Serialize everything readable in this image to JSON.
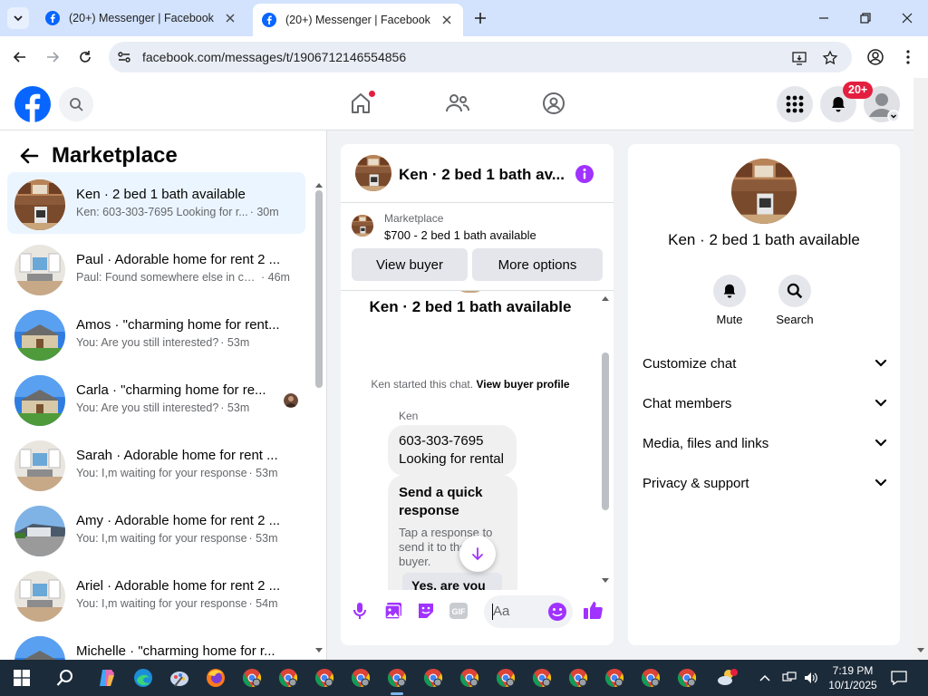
{
  "browser": {
    "tabs": [
      {
        "title": "(20+) Messenger | Facebook",
        "active": false
      },
      {
        "title": "(20+) Messenger | Facebook",
        "active": true
      }
    ],
    "url": "facebook.com/messages/t/1906712146554856"
  },
  "header": {
    "notification_badge": "20+"
  },
  "left_panel": {
    "title": "Marketplace",
    "conversations": [
      {
        "name": "Ken · 2 bed 1 bath available",
        "preview": "Ken: 603-303-7695 Looking for r...",
        "time": "· 30m",
        "selected": true,
        "thumb": "kitchen"
      },
      {
        "name": "Paul · Adorable home for rent 2 ...",
        "preview": "Paul: Found somewhere else in ca...",
        "time": "· 46m",
        "thumb": "living"
      },
      {
        "name": "Amos · \"charming home for rent...",
        "preview": "You: Are you still interested?",
        "time": "· 53m",
        "thumb": "house"
      },
      {
        "name": "Carla · \"charming home for re...",
        "preview": "You: Are you still interested?",
        "time": "· 53m",
        "thumb": "house"
      },
      {
        "name": "Sarah · Adorable home for rent ...",
        "preview": "You: I,m waiting for your response",
        "time": "· 53m",
        "thumb": "living"
      },
      {
        "name": "Amy · Adorable home for rent 2 ...",
        "preview": "You: I,m waiting for your response",
        "time": "· 53m",
        "thumb": "street"
      },
      {
        "name": "Ariel · Adorable home for rent 2 ...",
        "preview": "You: I,m waiting for your response",
        "time": "· 54m",
        "thumb": "living"
      },
      {
        "name": "Michelle · \"charming home for r...",
        "preview": "",
        "time": "",
        "thumb": "house"
      }
    ]
  },
  "chat": {
    "title": "Ken · 2 bed 1 bath av...",
    "marketplace_label": "Marketplace",
    "listing": "$700 - 2 bed 1 bath available",
    "view_buyer": "View buyer",
    "more_options": "More options",
    "intro_name": "Ken · 2 bed 1 bath available",
    "started_text": "Ken started this chat.",
    "view_buyer_profile": "View buyer profile",
    "sender": "Ken",
    "message_line1": "603-303-7695",
    "message_line2": "Looking for rental",
    "quick_title": "Send a quick response",
    "quick_sub": "Tap a response to send it to the buyer.",
    "quick_option": "Yes, are you",
    "composer_placeholder": "Aa"
  },
  "right_panel": {
    "name": "Ken · 2 bed 1 bath available",
    "mute": "Mute",
    "search": "Search",
    "sections": [
      "Customize chat",
      "Chat members",
      "Media, files and links",
      "Privacy & support"
    ]
  },
  "taskbar": {
    "time": "7:19 PM",
    "date": "10/1/2025"
  },
  "colors": {
    "fb_blue": "#0866ff",
    "messenger_purple": "#a033ff",
    "badge_red": "#e41e3f",
    "selected_bg": "#ebf5ff"
  }
}
